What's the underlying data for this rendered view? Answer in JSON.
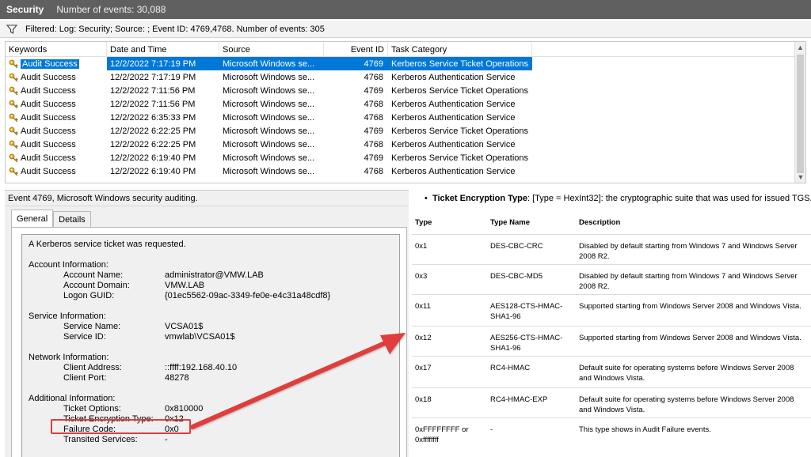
{
  "titlebar": {
    "log_name": "Security",
    "event_count": "Number of events: 30,088"
  },
  "filter": {
    "text": "Filtered: Log: Security; Source: ; Event ID: 4769,4768. Number of events: 305"
  },
  "list": {
    "columns": [
      "Keywords",
      "Date and Time",
      "Source",
      "Event ID",
      "Task Category"
    ],
    "rows": [
      {
        "kw": "Audit Success",
        "dt": "12/2/2022 7:17:19 PM",
        "src": "Microsoft Windows se...",
        "id": "4769",
        "cat": "Kerberos Service Ticket Operations"
      },
      {
        "kw": "Audit Success",
        "dt": "12/2/2022 7:17:19 PM",
        "src": "Microsoft Windows se...",
        "id": "4768",
        "cat": "Kerberos Authentication Service"
      },
      {
        "kw": "Audit Success",
        "dt": "12/2/2022 7:11:56 PM",
        "src": "Microsoft Windows se...",
        "id": "4769",
        "cat": "Kerberos Service Ticket Operations"
      },
      {
        "kw": "Audit Success",
        "dt": "12/2/2022 7:11:56 PM",
        "src": "Microsoft Windows se...",
        "id": "4768",
        "cat": "Kerberos Authentication Service"
      },
      {
        "kw": "Audit Success",
        "dt": "12/2/2022 6:35:33 PM",
        "src": "Microsoft Windows se...",
        "id": "4768",
        "cat": "Kerberos Authentication Service"
      },
      {
        "kw": "Audit Success",
        "dt": "12/2/2022 6:22:25 PM",
        "src": "Microsoft Windows se...",
        "id": "4769",
        "cat": "Kerberos Service Ticket Operations"
      },
      {
        "kw": "Audit Success",
        "dt": "12/2/2022 6:22:25 PM",
        "src": "Microsoft Windows se...",
        "id": "4768",
        "cat": "Kerberos Authentication Service"
      },
      {
        "kw": "Audit Success",
        "dt": "12/2/2022 6:19:40 PM",
        "src": "Microsoft Windows se...",
        "id": "4769",
        "cat": "Kerberos Service Ticket Operations"
      },
      {
        "kw": "Audit Success",
        "dt": "12/2/2022 6:19:40 PM",
        "src": "Microsoft Windows se...",
        "id": "4768",
        "cat": "Kerberos Authentication Service"
      }
    ],
    "selected_index": 0
  },
  "detail": {
    "header": "Event 4769, Microsoft Windows security auditing.",
    "tabs": [
      "General",
      "Details"
    ],
    "message": {
      "intro": "A Kerberos service ticket was requested.",
      "account_section": "Account Information:",
      "account_name_label": "Account Name:",
      "account_name": "administrator@VMW.LAB",
      "account_domain_label": "Account Domain:",
      "account_domain": "VMW.LAB",
      "logon_guid_label": "Logon GUID:",
      "logon_guid": "{01ec5562-09ac-3349-fe0e-e4c31a48cdf8}",
      "service_section": "Service Information:",
      "service_name_label": "Service Name:",
      "service_name": "VCSA01$",
      "service_id_label": "Service ID:",
      "service_id": "vmwlab\\VCSA01$",
      "network_section": "Network Information:",
      "client_address_label": "Client Address:",
      "client_address": "::ffff:192.168.40.10",
      "client_port_label": "Client Port:",
      "client_port": "48278",
      "additional_section": "Additional Information:",
      "ticket_options_label": "Ticket Options:",
      "ticket_options": "0x810000",
      "ticket_enc_label": "Ticket Encryption Type:",
      "ticket_enc": "0x12",
      "failure_code_label": "Failure Code:",
      "failure_code": "0x0",
      "transited_label": "Transited Services:",
      "transited": "-"
    }
  },
  "doc": {
    "bullet_term": "Ticket Encryption Type",
    "bullet_rest": ": [Type = HexInt32]: the cryptographic suite that was used for issued TGS.",
    "headers": [
      "Type",
      "Type Name",
      "Description"
    ],
    "rows": [
      {
        "type": "0x1",
        "name": "DES-CBC-CRC",
        "desc": "Disabled by default starting from Windows 7 and Windows Server 2008 R2."
      },
      {
        "type": "0x3",
        "name": "DES-CBC-MD5",
        "desc": "Disabled by default starting from Windows 7 and Windows Server 2008 R2."
      },
      {
        "type": "0x11",
        "name": "AES128-CTS-HMAC-SHA1-96",
        "desc": "Supported starting from Windows Server 2008 and Windows Vista."
      },
      {
        "type": "0x12",
        "name": "AES256-CTS-HMAC-SHA1-96",
        "desc": "Supported starting from Windows Server 2008 and Windows Vista."
      },
      {
        "type": "0x17",
        "name": "RC4-HMAC",
        "desc": "Default suite for operating systems before Windows Server 2008 and Windows Vista."
      },
      {
        "type": "0x18",
        "name": "RC4-HMAC-EXP",
        "desc": "Default suite for operating systems before Windows Server 2008 and Windows Vista."
      },
      {
        "type": "0xFFFFFFFF or 0xffffffff",
        "name": "-",
        "desc": "This type shows in Audit Failure events."
      }
    ]
  },
  "colors": {
    "selection": "#0078d7",
    "annotation": "#e03c3c",
    "titlebar": "#606060"
  },
  "icons": {
    "filter": "filter-funnel-icon",
    "key": "key-icon",
    "scroll_up": "scroll-up-icon",
    "scroll_down": "scroll-down-icon"
  }
}
